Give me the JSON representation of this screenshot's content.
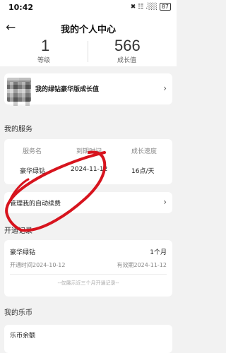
{
  "status_bar": {
    "time": "10:42",
    "signal": "✖ ☷ .░░",
    "battery": "87"
  },
  "header": {
    "title": "我的个人中心"
  },
  "stats": {
    "level_value": "1",
    "level_label": "等级",
    "growth_value": "566",
    "growth_label": "成长值"
  },
  "upgrade": {
    "label": "我的绿钻豪华版成长值"
  },
  "services": {
    "section_title": "我的服务",
    "columns": [
      "服务名",
      "到期时间",
      "成长速度"
    ],
    "rows": [
      {
        "name": "豪华绿钻",
        "expiry": "2024-11-12",
        "speed": "16点/天"
      }
    ],
    "auto_renew_label": "管理我的自动续费"
  },
  "records": {
    "section_title": "开通记录",
    "items": [
      {
        "name": "豪华绿钻",
        "duration": "1个月",
        "opened": "开通时间2024-10-12",
        "valid": "有效期2024-11-12"
      }
    ],
    "note": "--仅展示近三个月开通记录--"
  },
  "coins": {
    "section_title": "我的乐币",
    "balance_label": "乐币余额"
  },
  "colors": {
    "annotation": "#d7141e",
    "background": "#f2f2f2",
    "card": "#ffffff"
  }
}
